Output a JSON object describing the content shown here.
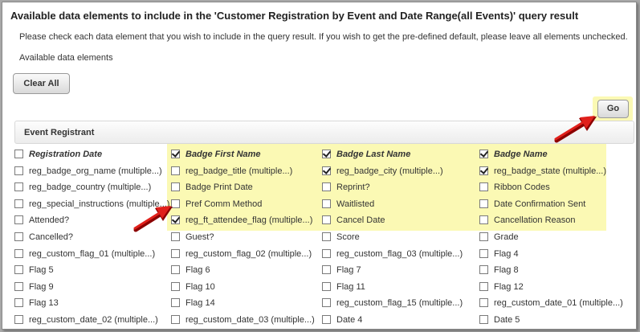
{
  "title": "Available data elements to include in the 'Customer Registration by Event and Date Range(all Events)' query result",
  "instruction": "Please check each data element that you wish to include in the query result. If you wish to get the pre-defined default, please leave all elements unchecked.",
  "available_label": "Available data elements",
  "clear_all_label": "Clear All",
  "go_label": "Go",
  "section_title": "Event Registrant",
  "columns": [
    [
      {
        "label": "Registration Date",
        "checked": false,
        "header": true
      },
      {
        "label": "reg_badge_org_name (multiple...)",
        "checked": false
      },
      {
        "label": "reg_badge_country (multiple...)",
        "checked": false
      },
      {
        "label": "reg_special_instructions (multiple...)",
        "checked": false
      },
      {
        "label": "Attended?",
        "checked": false
      },
      {
        "label": "Cancelled?",
        "checked": false
      },
      {
        "label": "reg_custom_flag_01 (multiple...)",
        "checked": false
      },
      {
        "label": "Flag 5",
        "checked": false
      },
      {
        "label": "Flag 9",
        "checked": false
      },
      {
        "label": "Flag 13",
        "checked": false
      },
      {
        "label": "reg_custom_date_02 (multiple...)",
        "checked": false
      }
    ],
    [
      {
        "label": "Badge First Name",
        "checked": true,
        "header": true
      },
      {
        "label": "reg_badge_title (multiple...)",
        "checked": false
      },
      {
        "label": "Badge Print Date",
        "checked": false
      },
      {
        "label": "Pref Comm Method",
        "checked": false
      },
      {
        "label": "reg_ft_attendee_flag (multiple...)",
        "checked": true
      },
      {
        "label": "Guest?",
        "checked": false
      },
      {
        "label": "reg_custom_flag_02 (multiple...)",
        "checked": false
      },
      {
        "label": "Flag 6",
        "checked": false
      },
      {
        "label": "Flag 10",
        "checked": false
      },
      {
        "label": "Flag 14",
        "checked": false
      },
      {
        "label": "reg_custom_date_03 (multiple...)",
        "checked": false
      }
    ],
    [
      {
        "label": "Badge Last Name",
        "checked": true,
        "header": true
      },
      {
        "label": "reg_badge_city (multiple...)",
        "checked": true
      },
      {
        "label": "Reprint?",
        "checked": false
      },
      {
        "label": "Waitlisted",
        "checked": false
      },
      {
        "label": "Cancel Date",
        "checked": false
      },
      {
        "label": "Score",
        "checked": false
      },
      {
        "label": "reg_custom_flag_03 (multiple...)",
        "checked": false
      },
      {
        "label": "Flag 7",
        "checked": false
      },
      {
        "label": "Flag 11",
        "checked": false
      },
      {
        "label": "reg_custom_flag_15 (multiple...)",
        "checked": false
      },
      {
        "label": "Date 4",
        "checked": false
      }
    ],
    [
      {
        "label": "Badge Name",
        "checked": true,
        "header": true
      },
      {
        "label": "reg_badge_state (multiple...)",
        "checked": true
      },
      {
        "label": "Ribbon Codes",
        "checked": false
      },
      {
        "label": "Date Confirmation Sent",
        "checked": false
      },
      {
        "label": "Cancellation Reason",
        "checked": false
      },
      {
        "label": "Grade",
        "checked": false
      },
      {
        "label": "Flag 4",
        "checked": false
      },
      {
        "label": "Flag 8",
        "checked": false
      },
      {
        "label": "Flag 12",
        "checked": false
      },
      {
        "label": "reg_custom_date_01 (multiple...)",
        "checked": false
      },
      {
        "label": "Date 5",
        "checked": false
      }
    ]
  ],
  "colors": {
    "highlight": "#fbf9b4",
    "arrow": "#e0201b"
  }
}
